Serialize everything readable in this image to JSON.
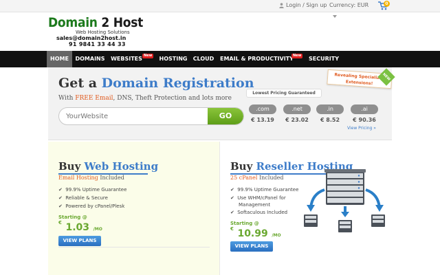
{
  "topbar": {
    "login_label": "Login / Sign up",
    "currency_label": "Currency:",
    "currency_value": "EUR",
    "cart_count": "0"
  },
  "logo": {
    "title_a": "Domain",
    "title_b": " 2 Host",
    "tagline": "Web Hosting Solutions",
    "email": "sales@domain2host.in",
    "phone": "91 9841 33 44 33"
  },
  "nav": {
    "items": [
      {
        "label": "HOME"
      },
      {
        "label": "DOMAINS"
      },
      {
        "label": "WEBSITES"
      },
      {
        "label": "HOSTING"
      },
      {
        "label": "CLOUD"
      },
      {
        "label": "EMAIL & PRODUCTIVITY"
      },
      {
        "label": "SECURITY"
      }
    ],
    "new_badge": "New"
  },
  "domain": {
    "title_a": "Get a ",
    "title_b": "Domain Registration",
    "subtitle_a": "With ",
    "subtitle_red": "FREE Email",
    "subtitle_b": ", DNS, Theft Protection and lots more",
    "search_placeholder": "YourWebsite",
    "search_button": "GO",
    "lowest_label": "Lowest Pricing Guaranteed",
    "ribbon_text": "Revealing Specialized Extensions!",
    "corner_badge": "NEW",
    "view_pricing": "View Pricing »",
    "tlds": [
      {
        "ext": ".com",
        "price": "€ 13.19"
      },
      {
        "ext": ".net",
        "price": "€ 23.02"
      },
      {
        "ext": ".in",
        "price": "€ 8.52"
      },
      {
        "ext": ".ai",
        "price": "€ 90.36"
      }
    ]
  },
  "hosting": {
    "web": {
      "title_a": "Buy ",
      "title_b": "Web Hosting",
      "sub_red": "Email Hosting",
      "sub_rest": " Included",
      "features": [
        "99.9% Uptime Guarantee",
        "Reliable & Secure",
        "Powered by cPanel/Plesk"
      ],
      "starting_label": "Starting @",
      "currency": "€",
      "price": "1.03",
      "period": "/MO",
      "button": "VIEW PLANS"
    },
    "reseller": {
      "title_a": "Buy ",
      "title_b": "Reseller Hosting",
      "sub_red": "25 cPanel",
      "sub_rest": " Included",
      "features": [
        "99.9% Uptime Guarantee",
        "Use WHM/cPanel for",
        "Management",
        "Softaculous Included"
      ],
      "starting_label": "Starting @",
      "currency": "€",
      "price": "10.99",
      "period": "/MO",
      "button": "VIEW PLANS"
    }
  },
  "colors": {
    "accent_blue": "#3d7cc9",
    "accent_green": "#6aa830",
    "accent_orange": "#e05a1e",
    "nav_bg": "#111111"
  }
}
